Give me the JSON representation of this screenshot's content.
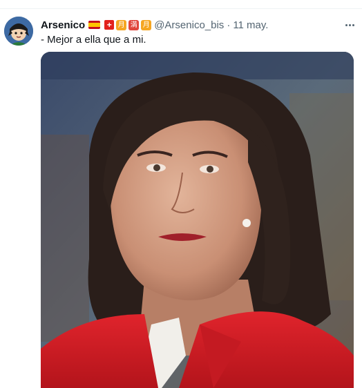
{
  "tweet": {
    "author_name": "Arsenico",
    "badges": [
      "spain-flag",
      "swiss-cross",
      "moon-kanji",
      "full-kanji",
      "moon-kanji"
    ],
    "badge_glyphs": {
      "swiss": "+",
      "moon1": "月",
      "full": "満",
      "moon2": "月"
    },
    "handle": "@Arsenico_bis",
    "separator": "·",
    "timestamp": "11 may.",
    "text": "- Mejor a ella que a mi.",
    "media": "photo"
  },
  "colors": {
    "name": "#0f1419",
    "secondary": "#536471",
    "divider": "#eff3f4"
  }
}
